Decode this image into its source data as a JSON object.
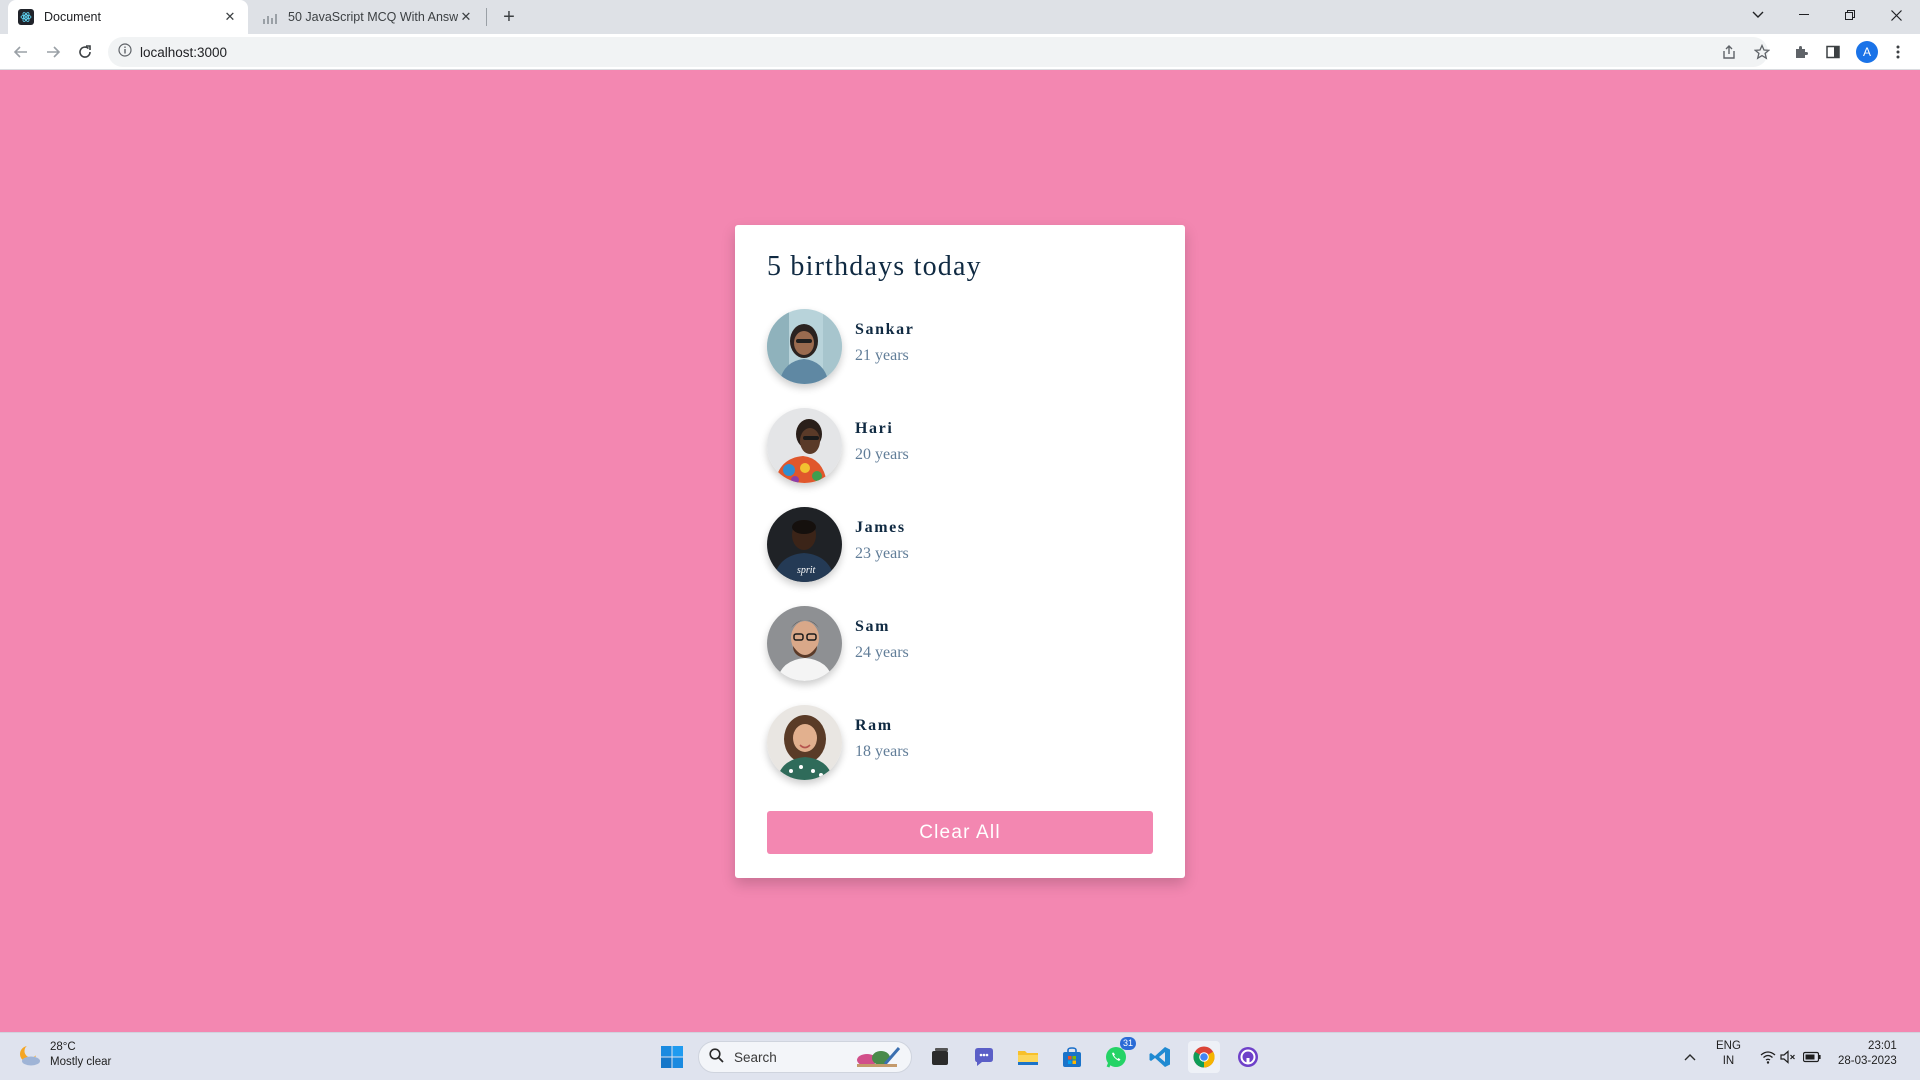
{
  "browser": {
    "tabs": [
      {
        "title": "Document",
        "active": true
      },
      {
        "title": "50 JavaScript MCQ With Answers",
        "active": false
      }
    ],
    "url": "localhost:3000",
    "profile_initial": "A"
  },
  "page": {
    "title": "5 birthdays today",
    "people": [
      {
        "name": "Sankar",
        "age": "21 years"
      },
      {
        "name": "Hari",
        "age": "20 years"
      },
      {
        "name": "James",
        "age": "23 years"
      },
      {
        "name": "Sam",
        "age": "24 years"
      },
      {
        "name": "Ram",
        "age": "18 years"
      }
    ],
    "clear_button": "Clear All"
  },
  "taskbar": {
    "weather_temp": "28°C",
    "weather_desc": "Mostly clear",
    "search_label": "Search",
    "whatsapp_badge": "31",
    "lang_line1": "ENG",
    "lang_line2": "IN",
    "time": "23:01",
    "date": "28-03-2023"
  },
  "colors": {
    "background": "#f387b1",
    "card": "#ffffff",
    "heading": "#102a42",
    "age_text": "#617d98"
  }
}
